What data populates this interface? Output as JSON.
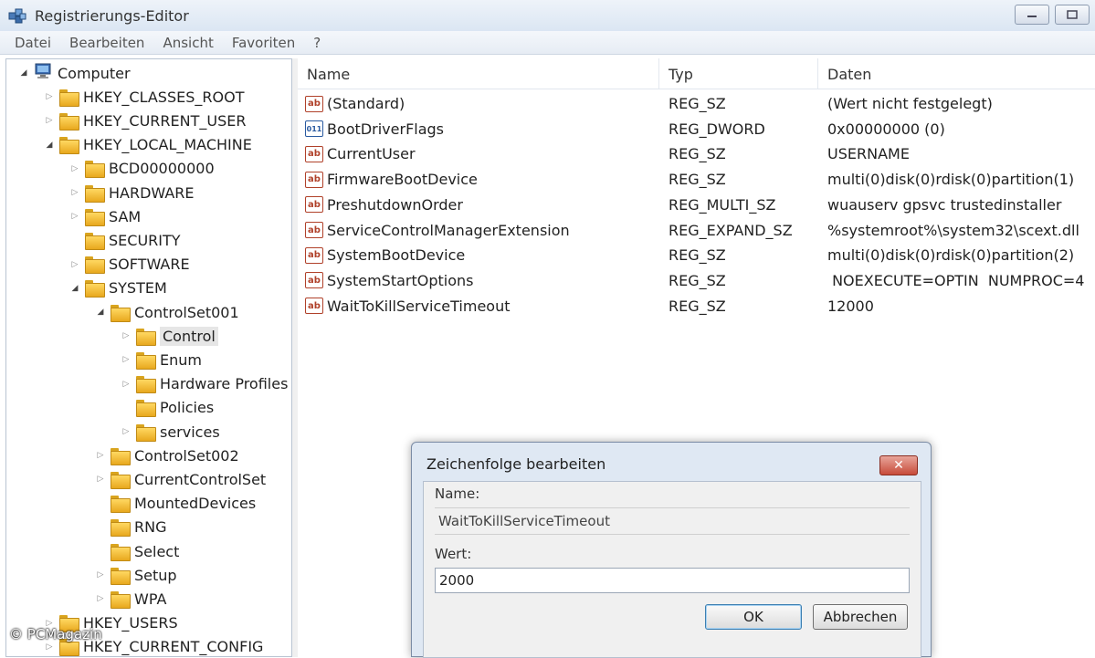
{
  "window": {
    "title": "Registrierungs-Editor"
  },
  "menu": [
    "Datei",
    "Bearbeiten",
    "Ansicht",
    "Favoriten",
    "?"
  ],
  "tree": [
    {
      "label": "Computer",
      "indent": 0,
      "expander": "expanded",
      "icon": "computer"
    },
    {
      "label": "HKEY_CLASSES_ROOT",
      "indent": 1,
      "expander": "collapsed"
    },
    {
      "label": "HKEY_CURRENT_USER",
      "indent": 1,
      "expander": "collapsed"
    },
    {
      "label": "HKEY_LOCAL_MACHINE",
      "indent": 1,
      "expander": "expanded"
    },
    {
      "label": "BCD00000000",
      "indent": 2,
      "expander": "collapsed"
    },
    {
      "label": "HARDWARE",
      "indent": 2,
      "expander": "collapsed"
    },
    {
      "label": "SAM",
      "indent": 2,
      "expander": "collapsed"
    },
    {
      "label": "SECURITY",
      "indent": 2,
      "expander": "none"
    },
    {
      "label": "SOFTWARE",
      "indent": 2,
      "expander": "collapsed"
    },
    {
      "label": "SYSTEM",
      "indent": 2,
      "expander": "expanded"
    },
    {
      "label": "ControlSet001",
      "indent": 3,
      "expander": "expanded"
    },
    {
      "label": "Control",
      "indent": 4,
      "expander": "collapsed",
      "selected": true
    },
    {
      "label": "Enum",
      "indent": 4,
      "expander": "collapsed"
    },
    {
      "label": "Hardware Profiles",
      "indent": 4,
      "expander": "collapsed"
    },
    {
      "label": "Policies",
      "indent": 4,
      "expander": "none"
    },
    {
      "label": "services",
      "indent": 4,
      "expander": "collapsed"
    },
    {
      "label": "ControlSet002",
      "indent": 3,
      "expander": "collapsed"
    },
    {
      "label": "CurrentControlSet",
      "indent": 3,
      "expander": "collapsed"
    },
    {
      "label": "MountedDevices",
      "indent": 3,
      "expander": "none"
    },
    {
      "label": "RNG",
      "indent": 3,
      "expander": "none"
    },
    {
      "label": "Select",
      "indent": 3,
      "expander": "none"
    },
    {
      "label": "Setup",
      "indent": 3,
      "expander": "collapsed"
    },
    {
      "label": "WPA",
      "indent": 3,
      "expander": "collapsed"
    },
    {
      "label": "HKEY_USERS",
      "indent": 1,
      "expander": "collapsed"
    },
    {
      "label": "HKEY_CURRENT_CONFIG",
      "indent": 1,
      "expander": "collapsed"
    }
  ],
  "columns": {
    "name": "Name",
    "type": "Typ",
    "data": "Daten"
  },
  "values": [
    {
      "icon": "ab",
      "name": "(Standard)",
      "type": "REG_SZ",
      "data": "(Wert nicht festgelegt)"
    },
    {
      "icon": "bin",
      "name": "BootDriverFlags",
      "type": "REG_DWORD",
      "data": "0x00000000 (0)"
    },
    {
      "icon": "ab",
      "name": "CurrentUser",
      "type": "REG_SZ",
      "data": "USERNAME"
    },
    {
      "icon": "ab",
      "name": "FirmwareBootDevice",
      "type": "REG_SZ",
      "data": "multi(0)disk(0)rdisk(0)partition(1)"
    },
    {
      "icon": "ab",
      "name": "PreshutdownOrder",
      "type": "REG_MULTI_SZ",
      "data": "wuauserv gpsvc trustedinstaller"
    },
    {
      "icon": "ab",
      "name": "ServiceControlManagerExtension",
      "type": "REG_EXPAND_SZ",
      "data": "%systemroot%\\system32\\scext.dll"
    },
    {
      "icon": "ab",
      "name": "SystemBootDevice",
      "type": "REG_SZ",
      "data": "multi(0)disk(0)rdisk(0)partition(2)"
    },
    {
      "icon": "ab",
      "name": "SystemStartOptions",
      "type": "REG_SZ",
      "data": " NOEXECUTE=OPTIN  NUMPROC=4"
    },
    {
      "icon": "ab",
      "name": "WaitToKillServiceTimeout",
      "type": "REG_SZ",
      "data": "12000"
    }
  ],
  "dialog": {
    "title": "Zeichenfolge bearbeiten",
    "name_label": "Name:",
    "name_value": "WaitToKillServiceTimeout",
    "value_label": "Wert:",
    "value_value": "2000",
    "ok_label": "OK",
    "cancel_label": "Abbrechen",
    "close_glyph": "✕"
  },
  "watermark": "© PCMagazin"
}
